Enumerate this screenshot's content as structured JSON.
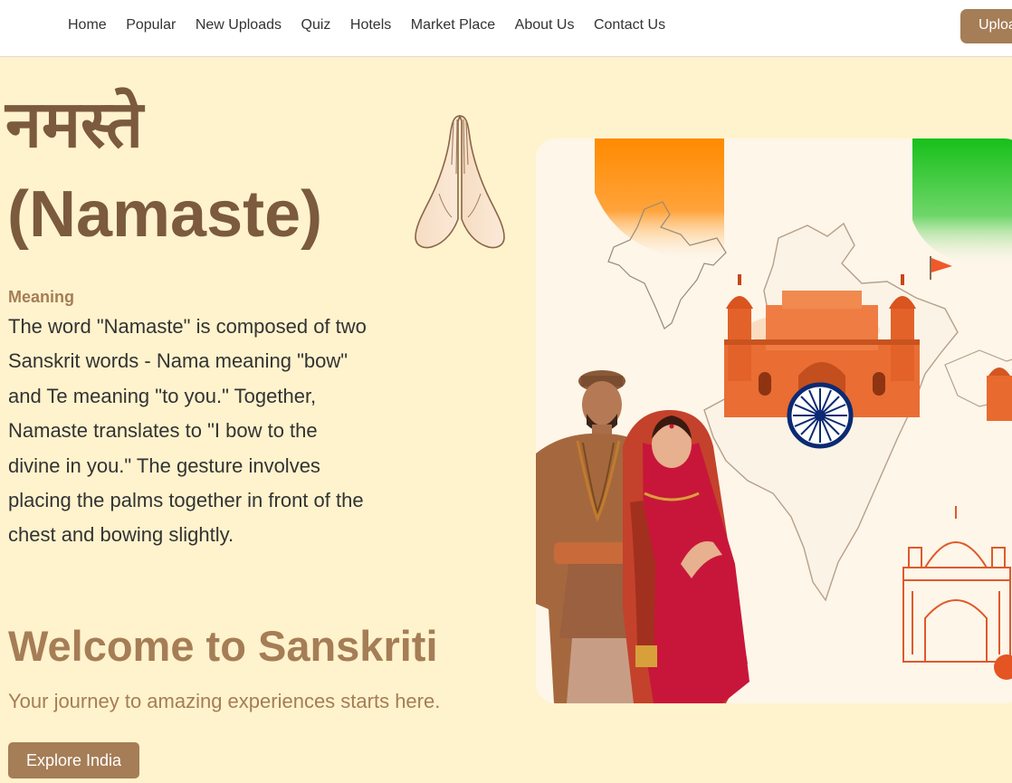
{
  "nav": {
    "links": [
      "Home",
      "Popular",
      "New Uploads",
      "Quiz",
      "Hotels",
      "Market Place",
      "About Us",
      "Contact Us"
    ],
    "upload_label": "Upload"
  },
  "hero": {
    "hindi_title": "नमस्ते",
    "latin_title": "(Namaste)",
    "meaning_label": "Meaning",
    "meaning_text": "The word \"Namaste\" is composed of two Sanskrit words - Nama meaning \"bow\" and Te meaning \"to you.\" Together, Namaste translates to \"I bow to the divine in you.\" The gesture involves placing the palms together in front of the chest and bowing slightly.",
    "welcome_title": "Welcome to Sanskriti",
    "tagline": "Your journey to amazing experiences starts here.",
    "explore_label": "Explore India"
  },
  "icons": {
    "hands": "praying-hands-icon",
    "flag": "flag-icon",
    "chakra": "ashoka-chakra-icon"
  },
  "colors": {
    "background": "#fff3cd",
    "accent": "#a57d56",
    "title": "#7b5a3d",
    "saffron": "#ff8c00",
    "green": "#1fbf1f",
    "navy": "#0b2a73",
    "fort": "#e86a2e"
  }
}
